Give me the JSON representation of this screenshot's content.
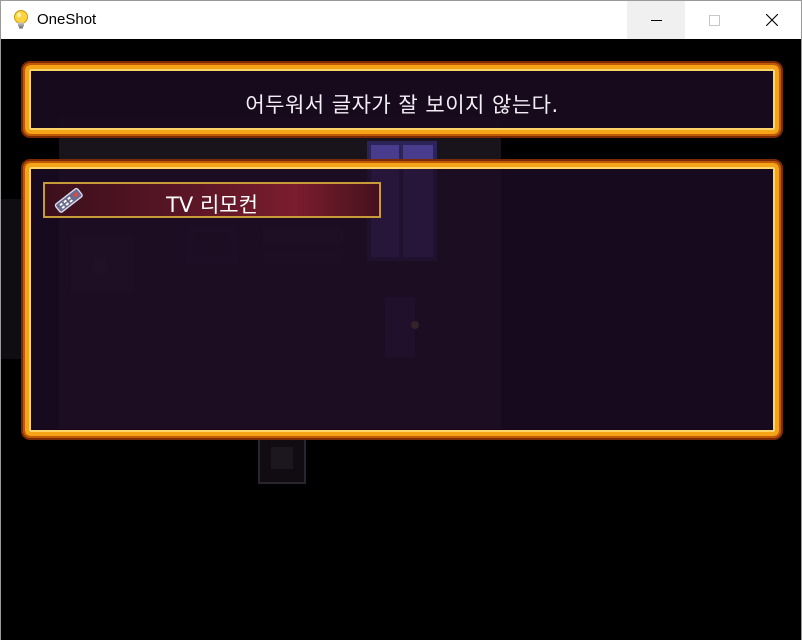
{
  "window": {
    "title": "OneShot",
    "app_icon": "lightbulb-icon",
    "controls": {
      "minimize_icon": "minimize-icon",
      "maximize_icon": "maximize-icon",
      "close_icon": "close-icon"
    }
  },
  "game": {
    "message": "어두워서 글자가 잘 보이지 않는다.",
    "inventory": {
      "items": [
        {
          "label": "TV 리모컨",
          "icon": "remote-control-icon",
          "selected": true
        }
      ]
    }
  },
  "colors": {
    "frame_gold": "#f5a418",
    "frame_dark": "#7a2a04",
    "panel_bg": "#1a0b1f",
    "selection": "#7a1d2e",
    "text": "#f3eef6"
  }
}
